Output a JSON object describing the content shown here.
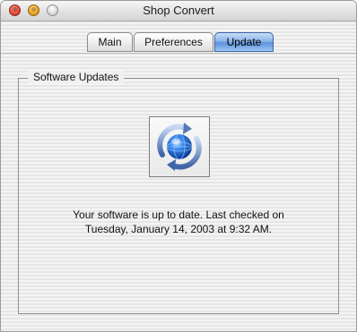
{
  "window": {
    "title": "Shop Convert"
  },
  "tabs": [
    {
      "label": "Main",
      "selected": false
    },
    {
      "label": "Preferences",
      "selected": false
    },
    {
      "label": "Update",
      "selected": true
    }
  ],
  "update": {
    "group_title": "Software Updates",
    "icon": "software-update-globe-icon",
    "status_line_1": "Your software is up to date. Last checked on",
    "status_line_2": "Tuesday, January 14, 2003 at 9:32 AM."
  },
  "colors": {
    "selected_tab": "#5d92dc",
    "close_button": "#f05e4c",
    "minimize_button": "#f7b53c"
  }
}
